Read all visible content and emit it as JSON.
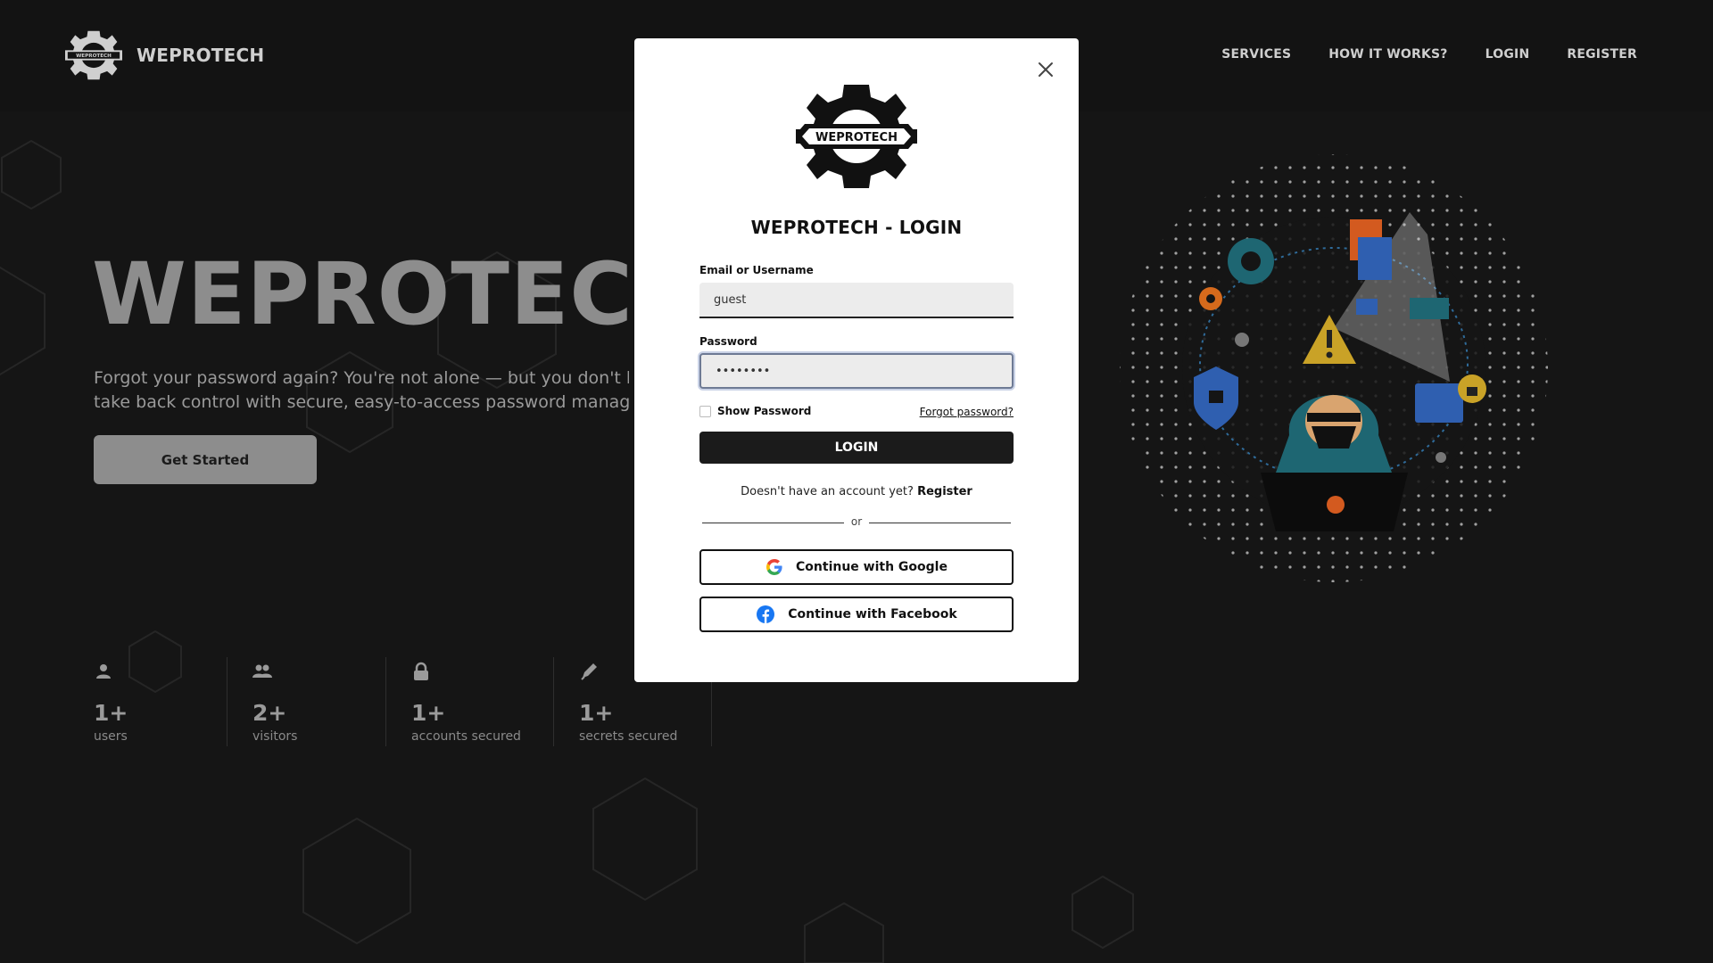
{
  "brand": {
    "name": "WEPROTECH",
    "logo_text": "WEPROTECH"
  },
  "nav": {
    "items": [
      {
        "label": "SERVICES"
      },
      {
        "label": "HOW IT WORKS?"
      },
      {
        "label": "LOGIN"
      },
      {
        "label": "REGISTER"
      }
    ]
  },
  "hero": {
    "title": "WEPROTECH",
    "line1": "Forgot your password again? You're not alone — but you don't have to",
    "line2": "take back control with secure, easy-to-access password managemen",
    "cta_label": "Get Started"
  },
  "stats": [
    {
      "value": "1+",
      "label": "users",
      "icon": "user-icon"
    },
    {
      "value": "2+",
      "label": "visitors",
      "icon": "users-icon"
    },
    {
      "value": "1+",
      "label": "accounts secured",
      "icon": "lock-icon"
    },
    {
      "value": "1+",
      "label": "secrets secured",
      "icon": "pen-icon"
    }
  ],
  "modal": {
    "title": "WEPROTECH - LOGIN",
    "logo_text": "WEPROTECH",
    "email_label": "Email or Username",
    "email_value": "guest",
    "password_label": "Password",
    "password_value": "••••••••",
    "show_password_label": "Show Password",
    "forgot_label": "Forgot password?",
    "login_label": "LOGIN",
    "register_prompt": "Doesn't have an account yet?",
    "register_label": "Register",
    "or_label": "or",
    "google_label": "Continue with Google",
    "facebook_label": "Continue with Facebook"
  },
  "colors": {
    "background": "#151515",
    "modal": "#ffffff",
    "primary_button": "#1b1b1b",
    "hero_title": "#8d8d8d",
    "google_blue": "#4285F4",
    "facebook_blue": "#1877F2"
  }
}
